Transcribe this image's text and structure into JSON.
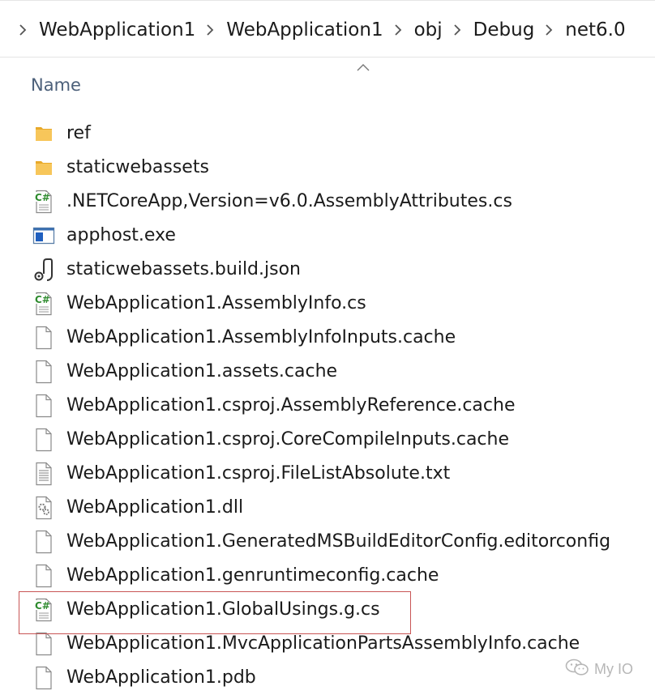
{
  "breadcrumb": {
    "items": [
      "WebApplication1",
      "WebApplication1",
      "obj",
      "Debug",
      "net6.0"
    ]
  },
  "header": {
    "name_column": "Name"
  },
  "files": [
    {
      "name": "ref",
      "icon": "folder-icon"
    },
    {
      "name": "staticwebassets",
      "icon": "folder-icon"
    },
    {
      "name": ".NETCoreApp,Version=v6.0.AssemblyAttributes.cs",
      "icon": "csharp-file-icon"
    },
    {
      "name": "apphost.exe",
      "icon": "exe-file-icon"
    },
    {
      "name": "staticwebassets.build.json",
      "icon": "json-file-icon"
    },
    {
      "name": "WebApplication1.AssemblyInfo.cs",
      "icon": "csharp-file-icon"
    },
    {
      "name": "WebApplication1.AssemblyInfoInputs.cache",
      "icon": "blank-file-icon"
    },
    {
      "name": "WebApplication1.assets.cache",
      "icon": "blank-file-icon"
    },
    {
      "name": "WebApplication1.csproj.AssemblyReference.cache",
      "icon": "blank-file-icon"
    },
    {
      "name": "WebApplication1.csproj.CoreCompileInputs.cache",
      "icon": "blank-file-icon"
    },
    {
      "name": "WebApplication1.csproj.FileListAbsolute.txt",
      "icon": "text-file-icon"
    },
    {
      "name": "WebApplication1.dll",
      "icon": "dll-file-icon"
    },
    {
      "name": "WebApplication1.GeneratedMSBuildEditorConfig.editorconfig",
      "icon": "blank-file-icon"
    },
    {
      "name": "WebApplication1.genruntimeconfig.cache",
      "icon": "blank-file-icon"
    },
    {
      "name": "WebApplication1.GlobalUsings.g.cs",
      "icon": "csharp-file-icon",
      "highlighted": true
    },
    {
      "name": "WebApplication1.MvcApplicationPartsAssemblyInfo.cache",
      "icon": "blank-file-icon"
    },
    {
      "name": "WebApplication1.pdb",
      "icon": "blank-file-icon"
    }
  ],
  "watermark": {
    "text": "My IO",
    "icon": "wechat-icon"
  },
  "colors": {
    "highlight_box": "#c85555",
    "header_text": "#4c607a",
    "folder": "#f7c65a"
  }
}
